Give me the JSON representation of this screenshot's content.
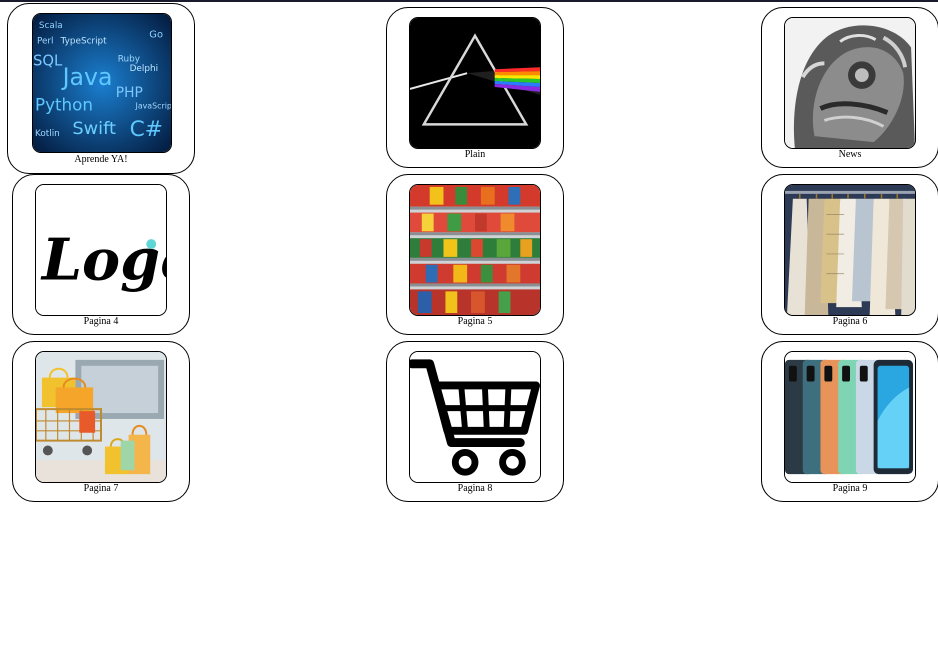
{
  "cards": [
    {
      "label": "Aprende YA!",
      "image": "programming-languages-image"
    },
    {
      "label": "Plain",
      "image": "prism-image"
    },
    {
      "label": "News",
      "image": "stone-lion-image"
    },
    {
      "label": "Pagina 4",
      "image": "logo-image"
    },
    {
      "label": "Pagina 5",
      "image": "supermarket-shelves-image"
    },
    {
      "label": "Pagina 6",
      "image": "clothes-rack-image"
    },
    {
      "label": "Pagina 7",
      "image": "shopping-bags-image"
    },
    {
      "label": "Pagina 8",
      "image": "shopping-cart-icon"
    },
    {
      "label": "Pagina 9",
      "image": "smartphones-image"
    }
  ],
  "thumb_text": {
    "languages": [
      "Scala",
      "Perl",
      "TypeScript",
      "SQL",
      "Java",
      "Ruby",
      "Delphi",
      "PHP",
      "Python",
      "JavaScript",
      "Swift",
      "Kotlin",
      "C#",
      "Go"
    ],
    "logo_word": "Logo"
  }
}
